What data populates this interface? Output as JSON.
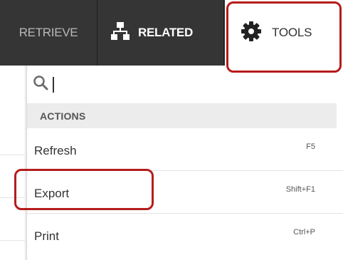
{
  "toolbar": {
    "tabs": {
      "retrieve": {
        "label": "RETRIEVE"
      },
      "related": {
        "label": "RELATED",
        "icon": "sitemap-icon"
      },
      "tools": {
        "label": "TOOLS",
        "icon": "gear-icon"
      }
    }
  },
  "dropdown": {
    "search": {
      "value": "",
      "icon": "search-icon"
    },
    "section": "ACTIONS",
    "items": [
      {
        "label": "Refresh",
        "shortcut": "F5"
      },
      {
        "label": "Export",
        "shortcut": "Shift+F1"
      },
      {
        "label": "Print",
        "shortcut": "Ctrl+P"
      }
    ]
  },
  "colors": {
    "toolbar_bg": "#353535",
    "highlight": "#b51c1c",
    "section_bg": "#ececec"
  }
}
